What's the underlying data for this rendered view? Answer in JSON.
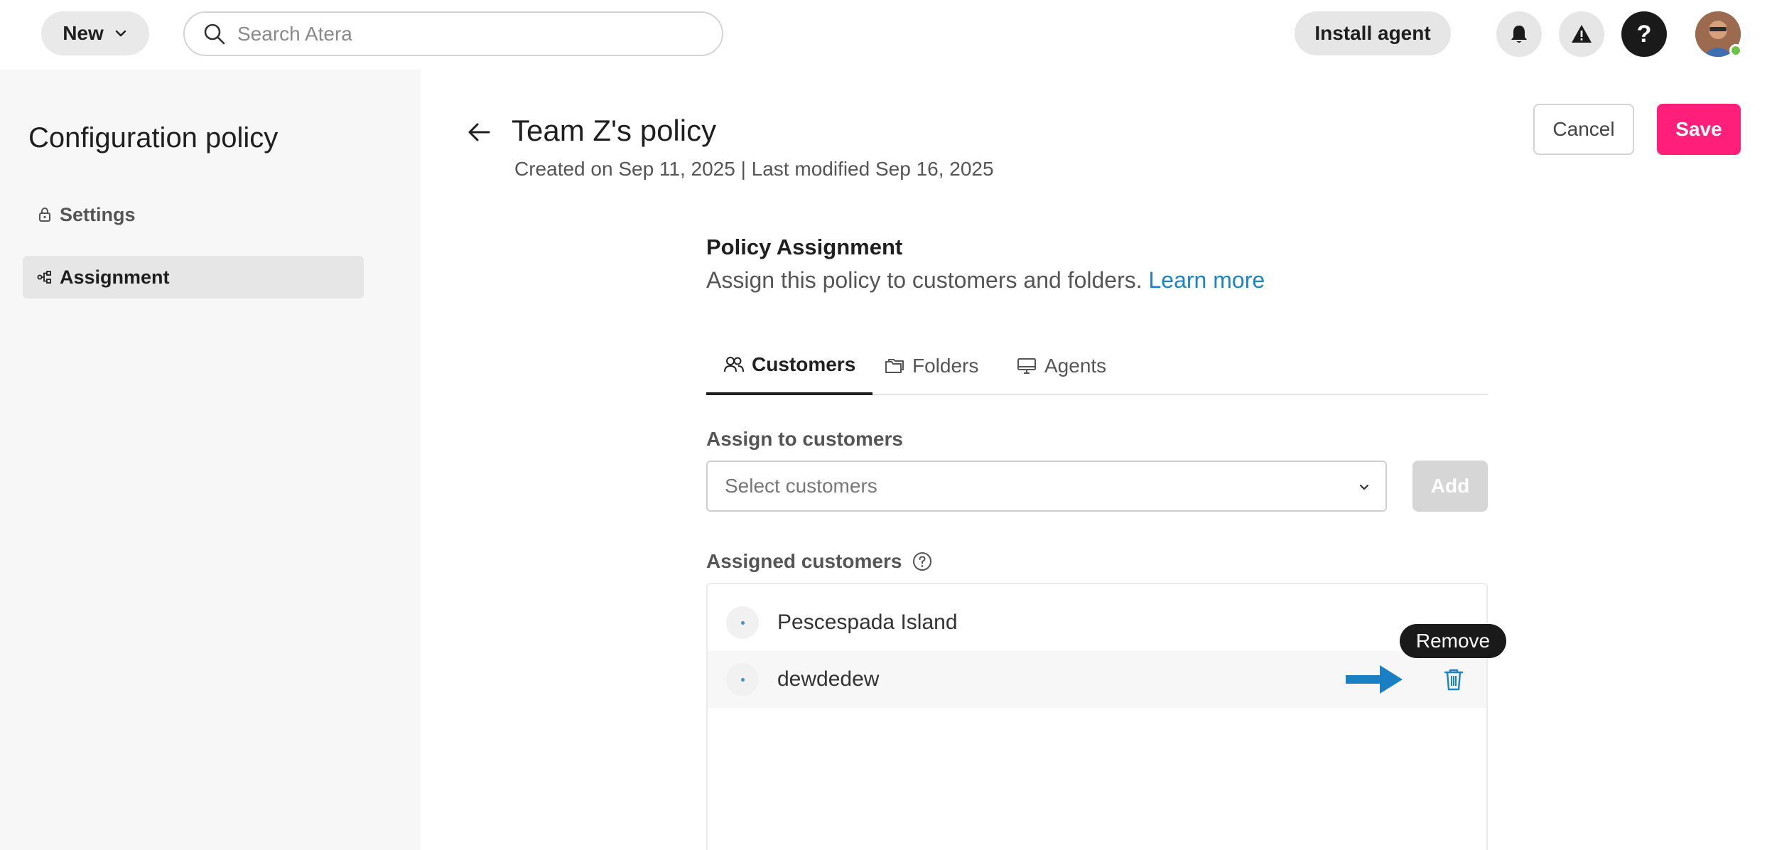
{
  "topbar": {
    "new_label": "New",
    "search_placeholder": "Search Atera",
    "install_label": "Install agent",
    "help_label": "?"
  },
  "sidebar": {
    "title": "Configuration policy",
    "items": [
      {
        "label": "Settings",
        "icon": "lock-icon"
      },
      {
        "label": "Assignment",
        "icon": "hierarchy-icon",
        "active": true
      }
    ]
  },
  "header": {
    "title": "Team Z's policy",
    "meta": "Created on Sep 11, 2025 | Last modified Sep 16, 2025",
    "cancel_label": "Cancel",
    "save_label": "Save"
  },
  "assignment": {
    "title": "Policy Assignment",
    "subtitle": "Assign this policy to customers and folders.",
    "learn_more": "Learn more",
    "tabs": [
      {
        "label": "Customers",
        "icon": "users-icon",
        "active": true
      },
      {
        "label": "Folders",
        "icon": "folders-icon"
      },
      {
        "label": "Agents",
        "icon": "monitor-icon"
      }
    ],
    "assign_label": "Assign to customers",
    "select_placeholder": "Select customers",
    "add_label": "Add",
    "assigned_label": "Assigned customers",
    "customers": [
      {
        "name": "Pescespada Island"
      },
      {
        "name": "dewdedew"
      }
    ],
    "tooltip": "Remove"
  },
  "colors": {
    "accent_pink": "#ff1e79",
    "link_blue": "#1b84c9",
    "arrow_blue": "#1b7fc4"
  }
}
